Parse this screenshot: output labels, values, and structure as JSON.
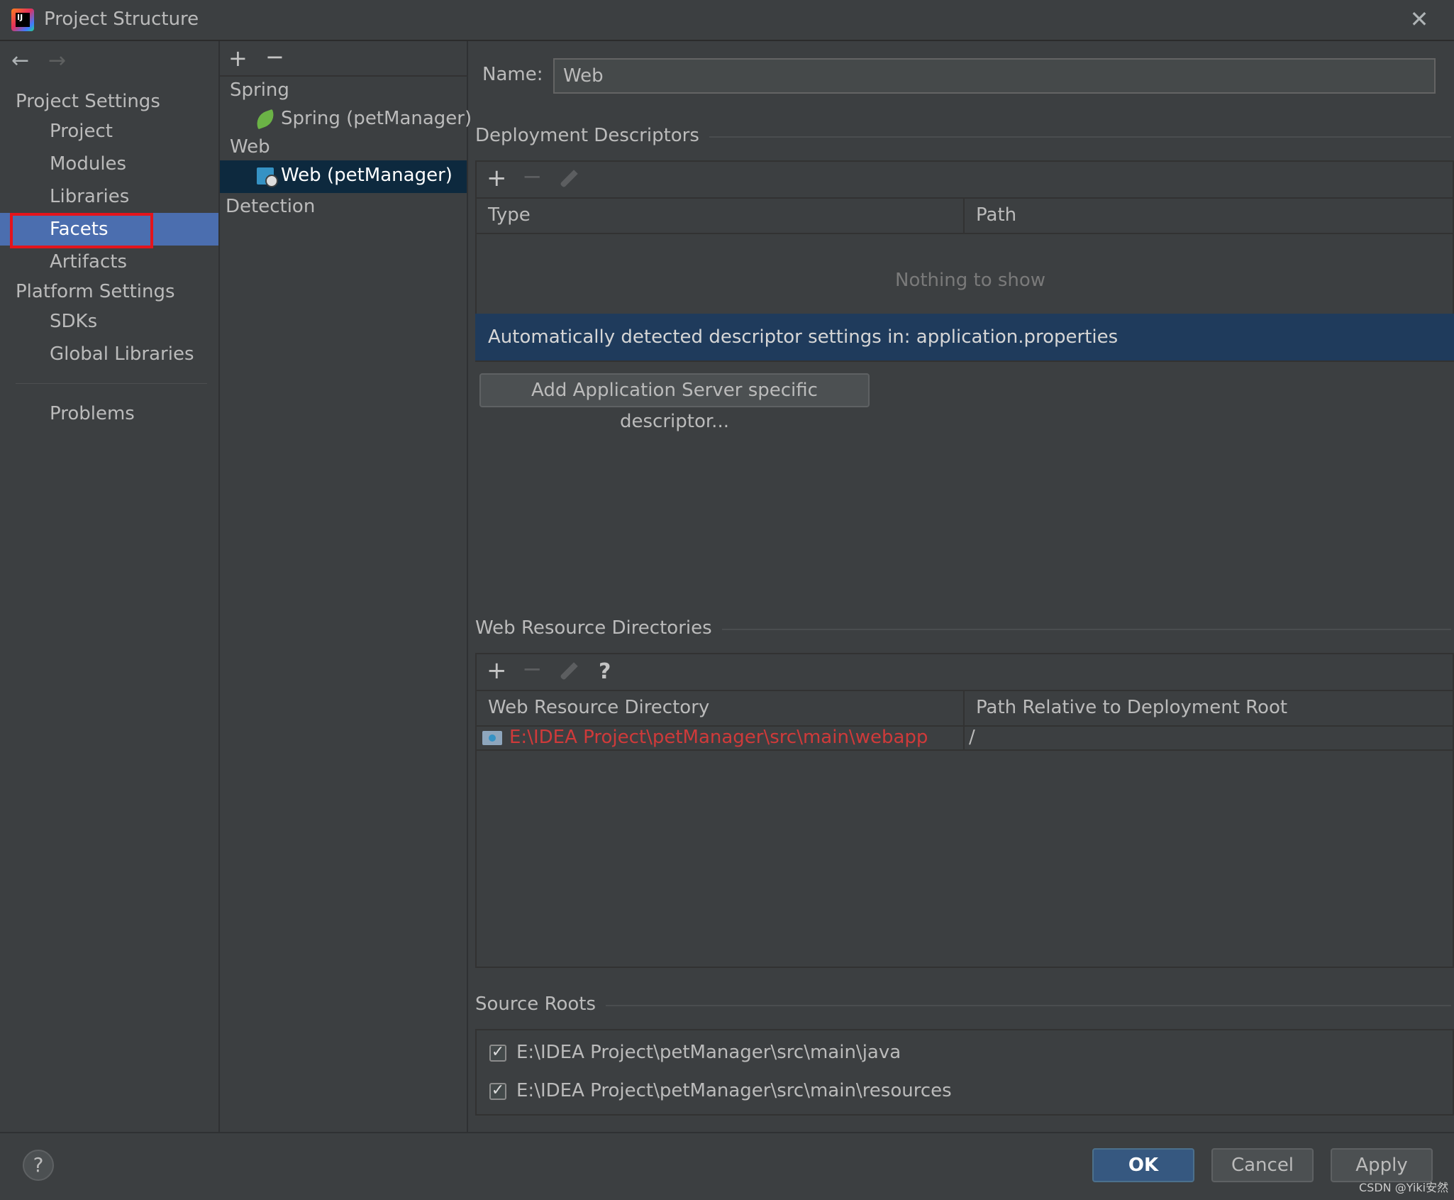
{
  "window": {
    "title": "Project Structure"
  },
  "nav": {
    "project_settings_label": "Project Settings",
    "project_settings_items": [
      "Project",
      "Modules",
      "Libraries",
      "Facets",
      "Artifacts"
    ],
    "selected_item": "Facets",
    "platform_settings_label": "Platform Settings",
    "platform_settings_items": [
      "SDKs",
      "Global Libraries"
    ],
    "problems_label": "Problems"
  },
  "facet_tree": {
    "groups": [
      {
        "label": "Spring",
        "children": [
          "Spring (petManager)"
        ]
      },
      {
        "label": "Web",
        "children": [
          "Web (petManager)"
        ]
      }
    ],
    "selected": "Web (petManager)",
    "detection_label": "Detection"
  },
  "name_field": {
    "label": "Name:",
    "value": "Web"
  },
  "deployment_descriptors": {
    "title": "Deployment Descriptors",
    "columns": [
      "Type",
      "Path"
    ],
    "empty_text": "Nothing to show",
    "detected_banner": "Automatically detected descriptor settings in: application.properties",
    "add_button_label": "Add Application Server specific descriptor..."
  },
  "web_resource_directories": {
    "title": "Web Resource Directories",
    "help_glyph": "?",
    "columns": [
      "Web Resource Directory",
      "Path Relative to Deployment Root"
    ],
    "rows": [
      {
        "directory": "E:\\IDEA Project\\petManager\\src\\main\\webapp",
        "relative_path": "/"
      }
    ]
  },
  "source_roots": {
    "title": "Source Roots",
    "items": [
      {
        "path": "E:\\IDEA Project\\petManager\\src\\main\\java",
        "checked": true
      },
      {
        "path": "E:\\IDEA Project\\petManager\\src\\main\\resources",
        "checked": true
      }
    ]
  },
  "buttons": {
    "ok": "OK",
    "cancel": "Cancel",
    "apply": "Apply",
    "help": "?"
  },
  "watermark": "CSDN @Yiki安然",
  "colors": {
    "background": "#3c3f41",
    "selection": "#4b6eaf",
    "tree_selection": "#0d293e",
    "banner": "#1f3b5c",
    "error_text": "#cf3a3a",
    "highlight_box": "#e4141b",
    "primary_button": "#365880"
  },
  "icons": {
    "app": "intellij-logo-icon",
    "close": "close-icon",
    "back": "arrow-left-icon",
    "forward": "arrow-right-icon",
    "add": "plus-icon",
    "remove": "minus-icon",
    "edit": "pencil-icon",
    "spring": "spring-leaf-icon",
    "web": "web-facet-icon",
    "folder": "web-folder-icon"
  }
}
